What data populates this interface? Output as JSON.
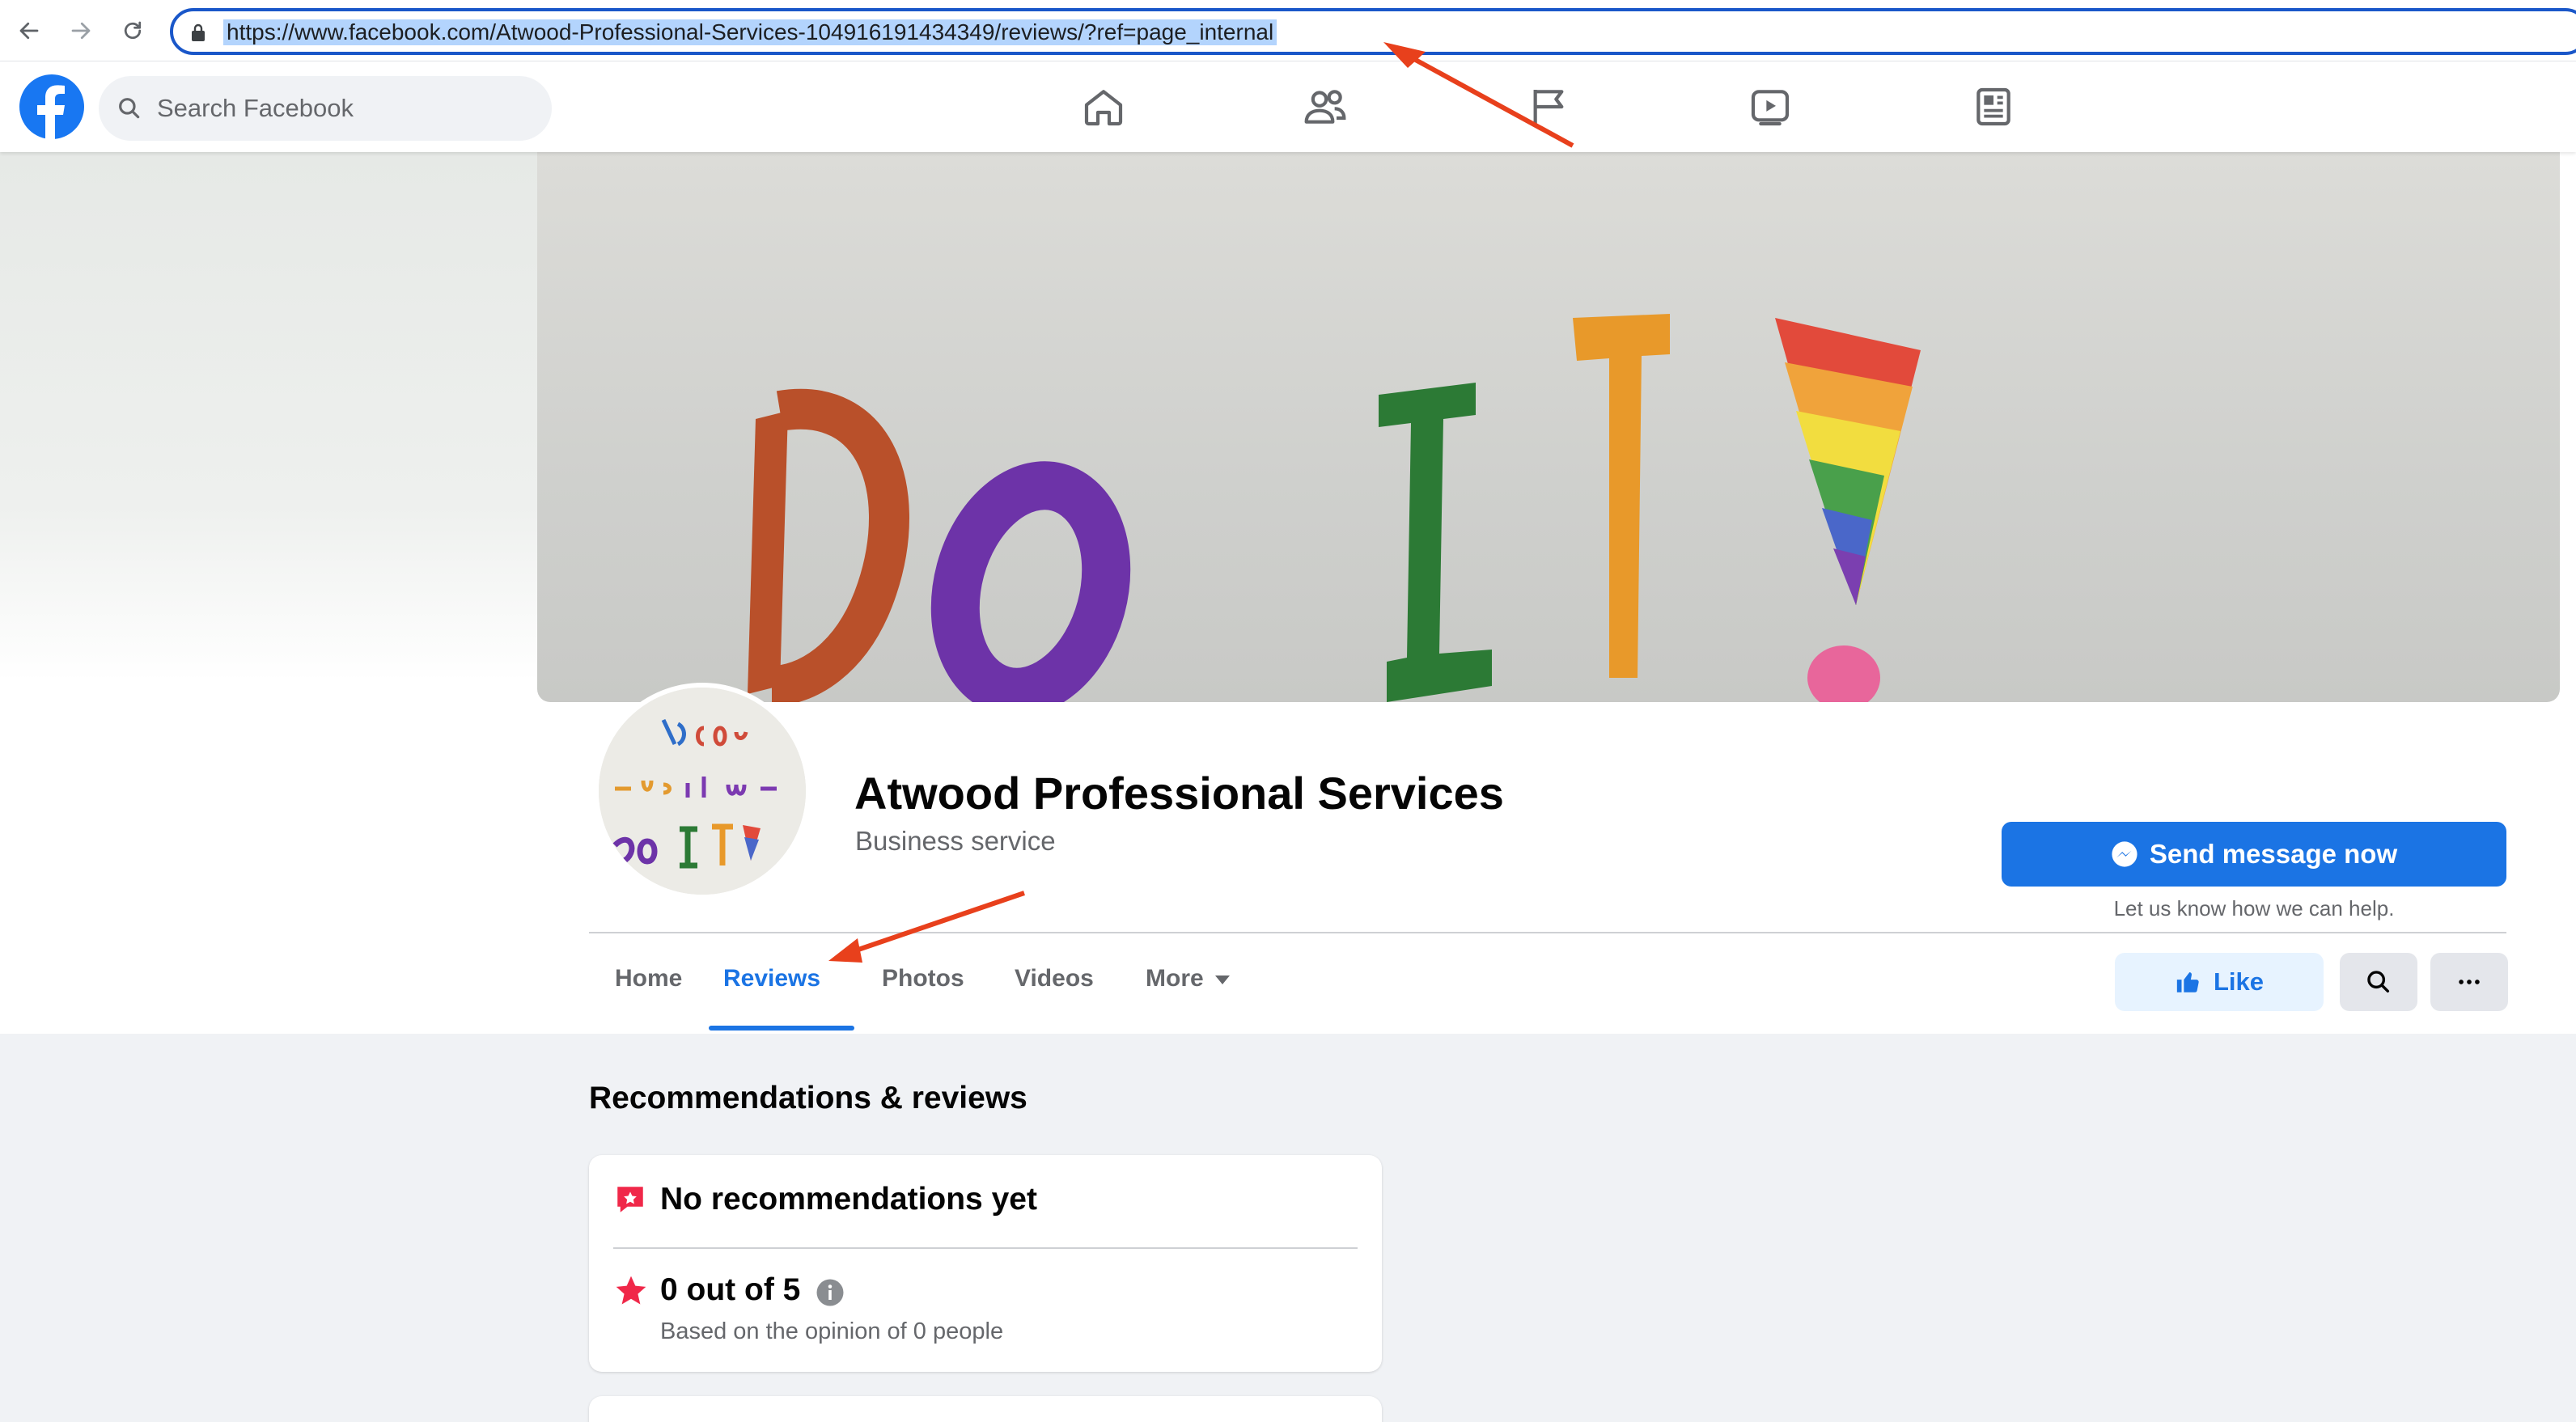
{
  "browser": {
    "url": "https://www.facebook.com/Atwood-Professional-Services-104916191434349/reviews/?ref=page_internal",
    "icons": [
      "back-icon",
      "forward-icon",
      "reload-icon",
      "lock-icon"
    ]
  },
  "fb_nav": {
    "search_placeholder": "Search Facebook",
    "icons": [
      "home-icon",
      "friends-icon",
      "pages-flag-icon",
      "watch-icon",
      "news-icon"
    ]
  },
  "page": {
    "name": "Atwood Professional Services",
    "category": "Business service",
    "send_button_label": "Send message now",
    "send_button_sub": "Let us know how we can help.",
    "tabs": [
      {
        "label": "Home",
        "active": false
      },
      {
        "label": "Reviews",
        "active": true
      },
      {
        "label": "Photos",
        "active": false
      },
      {
        "label": "Videos",
        "active": false
      },
      {
        "label": "More",
        "active": false
      }
    ],
    "like_label": "Like"
  },
  "reviews": {
    "section_title": "Recommendations & reviews",
    "no_recommendations": "No recommendations yet",
    "rating": "0 out of 5",
    "rating_sub": "Based on the opinion of 0 people"
  },
  "colors": {
    "accent": "#1b74e4",
    "annotation_arrow": "#e8401c",
    "rec_red": "#f02849"
  }
}
